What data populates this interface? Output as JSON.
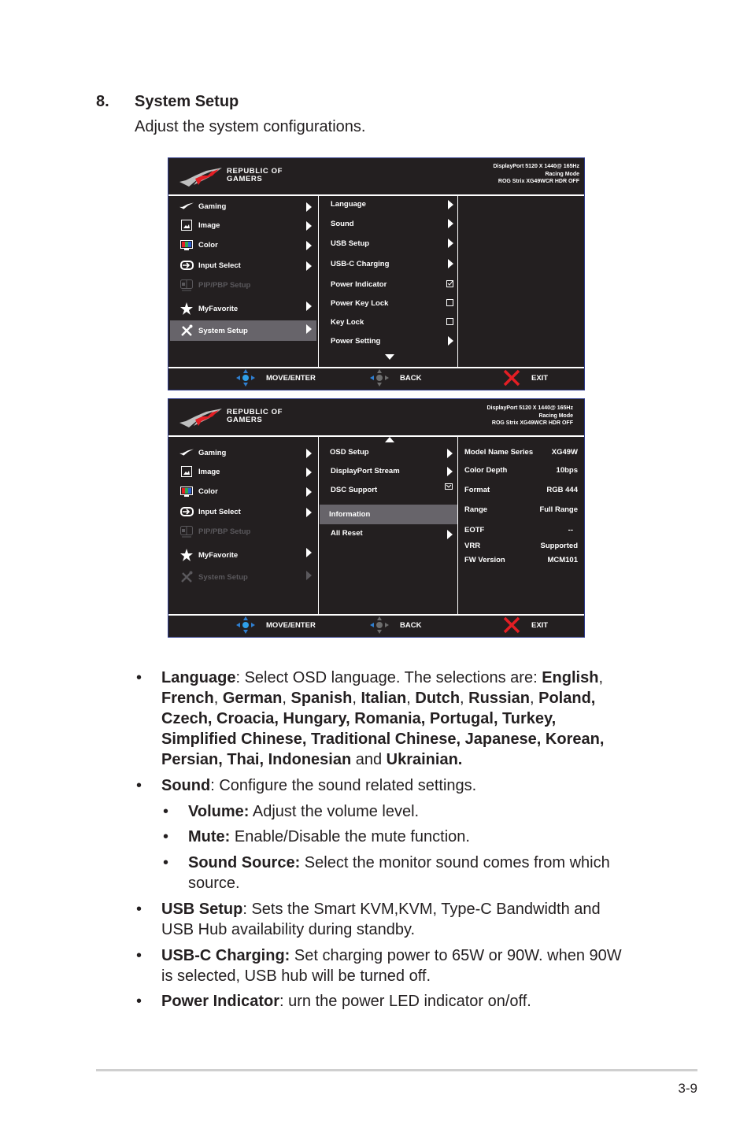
{
  "section": {
    "number": "8.",
    "title": "System Setup",
    "description": "Adjust the system configurations."
  },
  "osd_common": {
    "brand_line1": "REPUBLIC OF",
    "brand_line2": "GAMERS",
    "status_line1": "DisplayPort 5120 X 1440@ 165Hz",
    "status_line2": "Racing Mode",
    "status_line3": "ROG Strix XG49WCR HDR OFF",
    "footer": {
      "move_enter": "MOVE/ENTER",
      "back": "BACK",
      "exit": "EXIT"
    },
    "colors": {
      "background": "#231f20",
      "selected": "#67646a",
      "disabled": "#5a585c",
      "nav_blue": "#2f7fd1",
      "exit_red": "#e31e24",
      "border": "#2e3a8c"
    }
  },
  "main_menu": [
    {
      "label": "Gaming",
      "icon": "rog-icon"
    },
    {
      "label": "Image",
      "icon": "image-icon"
    },
    {
      "label": "Color",
      "icon": "color-icon"
    },
    {
      "label": "Input Select",
      "icon": "input-icon"
    },
    {
      "label": "PIP/PBP Setup",
      "icon": "pip-icon"
    },
    {
      "label": "MyFavorite",
      "icon": "star-icon"
    },
    {
      "label": "System Setup",
      "icon": "tools-icon"
    }
  ],
  "osd1": {
    "selected_main": "System Setup",
    "submenu": [
      {
        "label": "Language",
        "control": "arrow"
      },
      {
        "label": "Sound",
        "control": "arrow"
      },
      {
        "label": "USB Setup",
        "control": "arrow"
      },
      {
        "label": "USB-C Charging",
        "control": "arrow"
      },
      {
        "label": "Power Indicator",
        "control": "checkbox",
        "checked": true
      },
      {
        "label": "Power Key Lock",
        "control": "checkbox",
        "checked": false
      },
      {
        "label": "Key Lock",
        "control": "checkbox",
        "checked": false
      },
      {
        "label": "Power Setting",
        "control": "arrow"
      }
    ]
  },
  "osd2": {
    "selected_sub": "Information",
    "submenu": [
      {
        "label": "OSD Setup",
        "control": "arrow"
      },
      {
        "label": "DisplayPort Stream",
        "control": "arrow"
      },
      {
        "label": "DSC Support",
        "control": "checkbox",
        "checked": true
      },
      {
        "label": "Information",
        "control": "none"
      },
      {
        "label": "All Reset",
        "control": "arrow"
      }
    ],
    "information": [
      {
        "key": "Model Name Series",
        "value": "XG49W"
      },
      {
        "key": "Color Depth",
        "value": "10bps"
      },
      {
        "key": "Format",
        "value": "RGB 444"
      },
      {
        "key": "Range",
        "value": "Full Range"
      },
      {
        "key": "EOTF",
        "value": "--"
      },
      {
        "key": "VRR",
        "value": "Supported"
      },
      {
        "key": "FW Version",
        "value": "MCM101"
      }
    ]
  },
  "bullets": {
    "language": {
      "term": "Language",
      "text1": ": Select OSD language. The selections are: ",
      "l_english": "English",
      "l_french": "French",
      "l_german": "German",
      "l_spanish": "Spanish",
      "l_italian": "Italian",
      "l_dutch": "Dutch",
      "l_russian": "Russian",
      "l_rest1": "Poland,",
      "l_rest2": "Czech, Croacia, Hungary, Romania, Portugal, Turkey,",
      "l_rest3": "Simplified Chinese, Traditional Chinese, Japanese, Korean,",
      "l_rest4": "Persian, Thai, Indonesian",
      "and": " and ",
      "l_last": "Ukrainian."
    },
    "sound": {
      "term": "Sound",
      "text": ": Configure the sound related settings.",
      "sub": [
        {
          "term": "Volume:",
          "text": " Adjust the volume level."
        },
        {
          "term": "Mute:",
          "text": " Enable/Disable the mute function."
        },
        {
          "term": "Sound Source:",
          "text": " Select the monitor sound comes from which",
          "text2": "source."
        }
      ]
    },
    "usb_setup": {
      "term": "USB Setup",
      "text": ": Sets the Smart KVM,KVM, Type-C Bandwidth and",
      "text2": "USB Hub availability during standby."
    },
    "usbc_charging": {
      "term": "USB-C Charging:",
      "text": " Set charging power to 65W or 90W. when 90W",
      "text2": "is selected, USB hub will be turned off."
    },
    "power_indicator": {
      "term": "Power Indicator",
      "text": ": urn the power LED indicator on/off."
    }
  },
  "page_number": "3-9"
}
